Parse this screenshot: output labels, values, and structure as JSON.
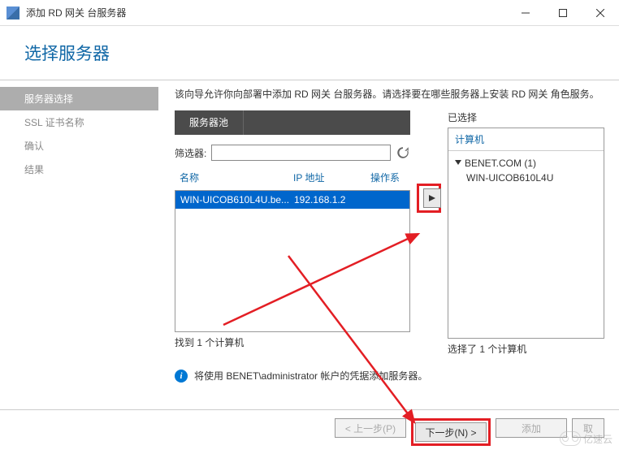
{
  "window": {
    "title": "添加 RD 网关 台服务器"
  },
  "header": {
    "title": "选择服务器"
  },
  "sidebar": {
    "items": [
      {
        "label": "服务器选择",
        "active": true
      },
      {
        "label": "SSL 证书名称",
        "active": false
      },
      {
        "label": "确认",
        "active": false
      },
      {
        "label": "结果",
        "active": false
      }
    ]
  },
  "main": {
    "description": "该向导允许你向部署中添加 RD 网关 台服务器。请选择要在哪些服务器上安装 RD 网关 角色服务。",
    "pool": {
      "tab": "服务器池",
      "filter_label": "筛选器:",
      "filter_value": "",
      "columns": {
        "name": "名称",
        "ip": "IP 地址",
        "os": "操作系"
      },
      "rows": [
        {
          "name": "WIN-UICOB610L4U.be...",
          "ip": "192.168.1.2",
          "selected": true
        }
      ],
      "found_text": "找到 1 个计算机"
    },
    "selected": {
      "title": "已选择",
      "header": "计算机",
      "group": "BENET.COM (1)",
      "computer": "WIN-UICOB610L4U",
      "count_text": "选择了 1 个计算机"
    },
    "info": "将使用 BENET\\administrator 帐户的凭据添加服务器。"
  },
  "footer": {
    "prev": "< 上一步(P)",
    "next": "下一步(N) >",
    "add": "添加",
    "cancel": "取"
  },
  "watermark": "亿速云"
}
